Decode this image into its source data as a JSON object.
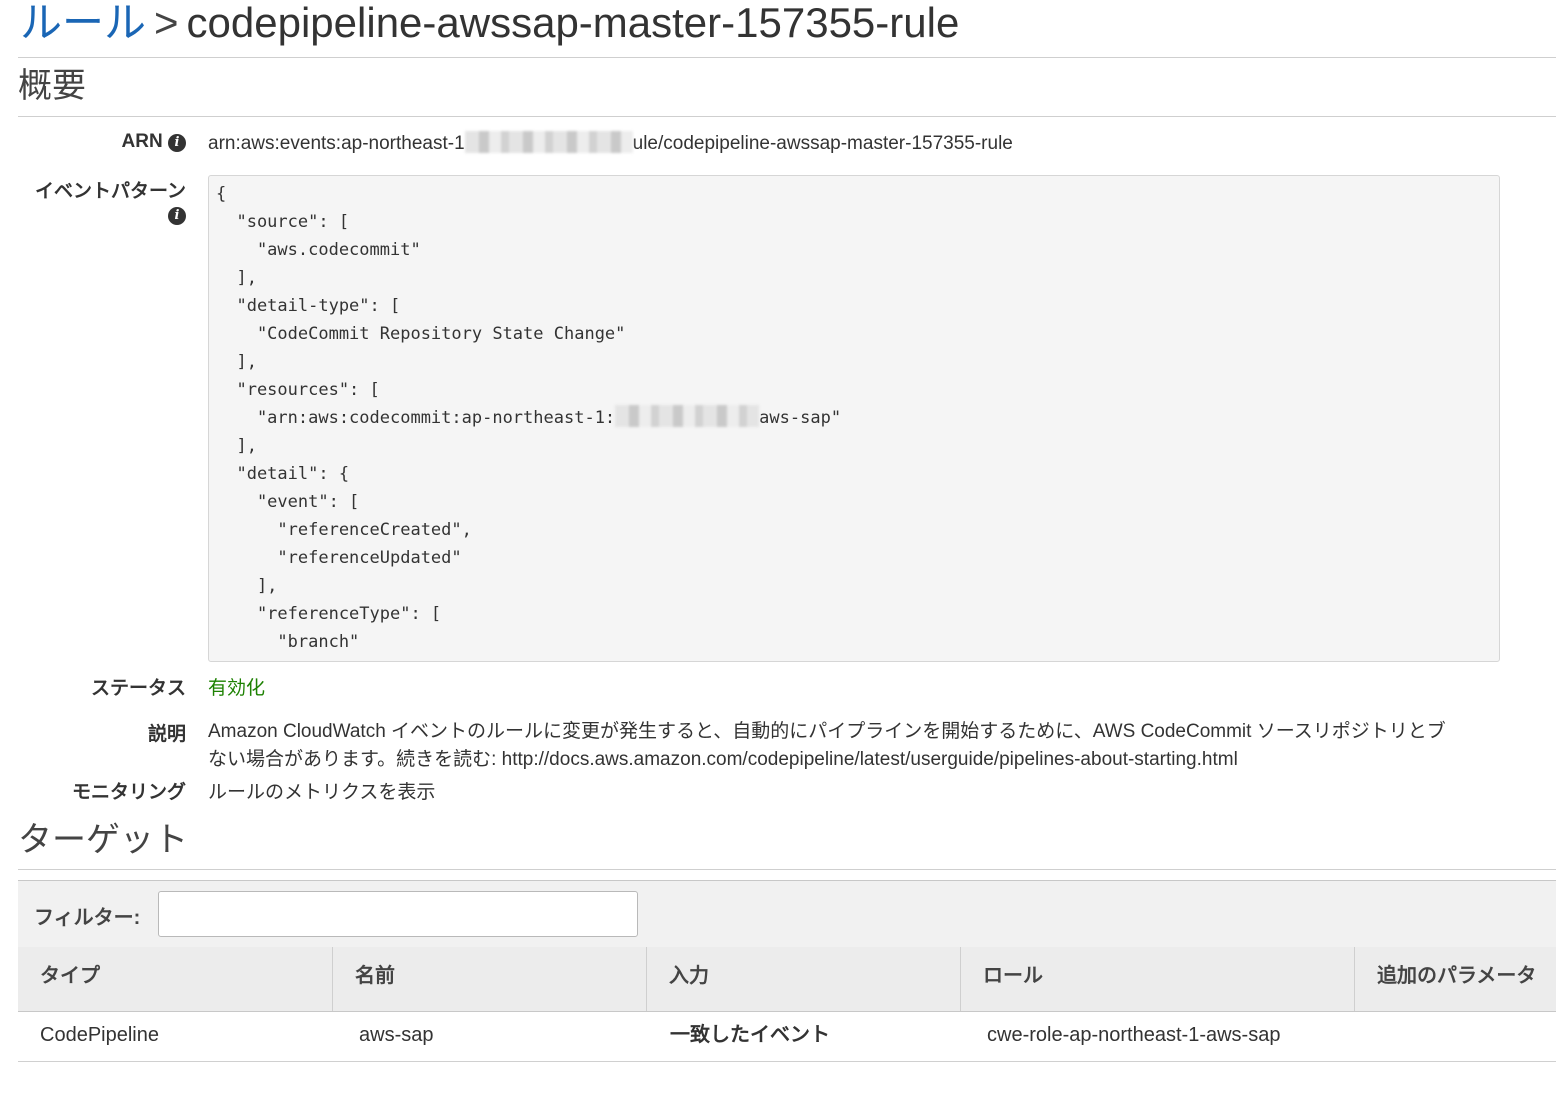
{
  "breadcrumb": {
    "parent_link": "ルール",
    "separator": ">",
    "rule_name": "codepipeline-awssap-master-157355-rule"
  },
  "overview": {
    "heading": "概要",
    "arn": {
      "label": "ARN",
      "value_prefix": "arn:aws:events:ap-northeast-1",
      "value_suffix": "ule/codepipeline-awssap-master-157355-rule"
    },
    "event_pattern": {
      "label": "イベントパターン",
      "lines": [
        "{",
        "  \"source\": [",
        "    \"aws.codecommit\"",
        "  ],",
        "  \"detail-type\": [",
        "    \"CodeCommit Repository State Change\"",
        "  ],",
        "  \"resources\": [",
        "    \"arn:aws:codecommit:ap-northeast-1:REDACTED_PLACEHOLDERaws-sap\"",
        "  ],",
        "  \"detail\": {",
        "    \"event\": [",
        "      \"referenceCreated\",",
        "      \"referenceUpdated\"",
        "    ],",
        "    \"referenceType\": [",
        "      \"branch\"",
        "    ]"
      ],
      "resource_prefix": "    \"arn:aws:codecommit:ap-northeast-1:",
      "resource_suffix": "aws-sap\""
    },
    "status": {
      "label": "ステータス",
      "value": "有効化",
      "color": "#1d8102"
    },
    "description": {
      "label": "説明",
      "line1": "Amazon CloudWatch イベントのルールに変更が発生すると、自動的にパイプラインを開始するために、AWS CodeCommit ソースリポジトリとブ",
      "line2": "ない場合があります。続きを読む: http://docs.aws.amazon.com/codepipeline/latest/userguide/pipelines-about-starting.html"
    },
    "monitoring": {
      "label": "モニタリング",
      "link": "ルールのメトリクスを表示"
    }
  },
  "targets": {
    "heading": "ターゲット",
    "filter_label": "フィルター:",
    "filter_value": "",
    "columns": [
      "タイプ",
      "名前",
      "入力",
      "ロール",
      "追加のパラメータ"
    ],
    "rows": [
      {
        "type": "CodePipeline",
        "name": "aws-sap",
        "input": "一致したイベント",
        "role": "cwe-role-ap-northeast-1-aws-sap",
        "extra": ""
      }
    ]
  },
  "colors": {
    "link": "#1a66b5",
    "status_enabled": "#1d8102"
  }
}
